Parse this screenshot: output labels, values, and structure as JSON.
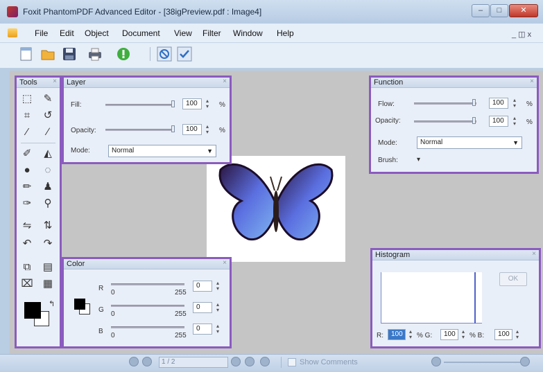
{
  "window": {
    "title": "Foxit PhantomPDF Advanced Editor - [38igPreview.pdf : Image4]",
    "min": "–",
    "max": "□",
    "close": "✕"
  },
  "menu": {
    "items": [
      "File",
      "Edit",
      "Object",
      "Document",
      "View",
      "Filter",
      "Window",
      "Help"
    ],
    "mdi_controls": "_ ◫ x"
  },
  "toolbar": {
    "icons": [
      "new-icon",
      "open-icon",
      "save-icon",
      "print-icon",
      "go-icon",
      "cancel-icon",
      "ok-icon"
    ]
  },
  "tools": {
    "title": "Tools",
    "close": "×"
  },
  "layer": {
    "title": "Layer",
    "close": "×",
    "fill_label": "Fill:",
    "fill_value": "100",
    "opacity_label": "Opacity:",
    "opacity_value": "100",
    "percent": "%",
    "mode_label": "Mode:",
    "mode_value": "Normal"
  },
  "function": {
    "title": "Function",
    "close": "×",
    "flow_label": "Flow:",
    "flow_value": "100",
    "opacity_label": "Opacity:",
    "opacity_value": "100",
    "percent": "%",
    "mode_label": "Mode:",
    "mode_value": "Normal",
    "brush_label": "Brush:",
    "brush_value": "▾"
  },
  "color": {
    "title": "Color",
    "close": "×",
    "r_label": "R",
    "g_label": "G",
    "b_label": "B",
    "min": "0",
    "max": "255",
    "r_value": "0",
    "g_value": "0",
    "b_value": "0"
  },
  "histogram": {
    "title": "Histogram",
    "close": "×",
    "ok": "OK",
    "r_label": "R:",
    "r_value": "100",
    "g_label": "% G:",
    "g_value": "100",
    "b_label": "% B:",
    "b_value": "100",
    "percent": "%"
  },
  "status": {
    "page": "1 / 2",
    "show_comments": "Show Comments"
  },
  "colors": {
    "panel_border": "#8b5bbf",
    "accent": "#3a78c8"
  }
}
